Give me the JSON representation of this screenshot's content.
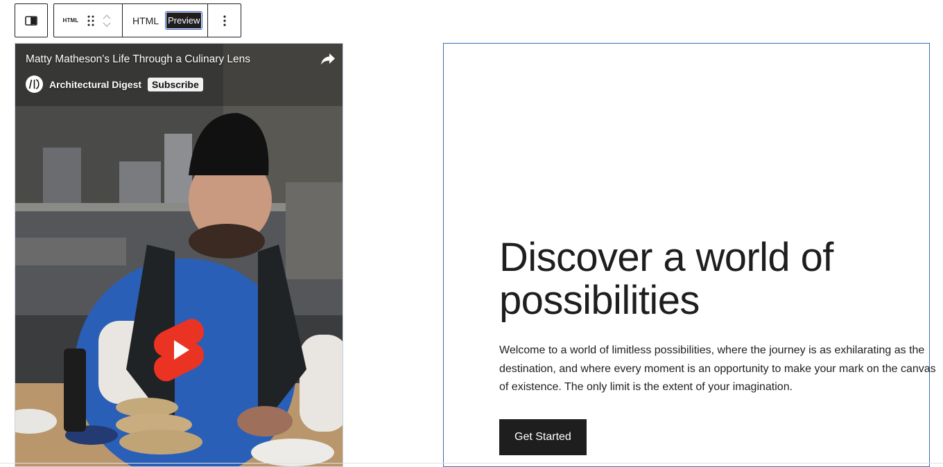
{
  "toolbar": {
    "block_type_label": "HTML",
    "mode_html_label": "HTML",
    "mode_preview_label": "Preview"
  },
  "video": {
    "title": "Matty Matheson's Life Through a Culinary Lens",
    "channel_name": "Architectural Digest",
    "subscribe_label": "Subscribe",
    "play_color": "#ea3323"
  },
  "hero": {
    "title": "Discover a world of possibilities",
    "text": "Welcome to a world of limitless possibilities, where the journey is as exhilarating as the destination, and where every moment is an opportunity to make your mark on the canvas of existence. The only limit is the extent of your imagination.",
    "cta_label": "Get Started"
  },
  "colors": {
    "selected_border": "#3a69b0",
    "button_bg": "#1e1e1e"
  }
}
